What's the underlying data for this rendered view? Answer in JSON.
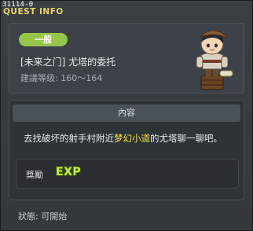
{
  "window": {
    "quest_id": "31114-0",
    "title": "QUEST INFO"
  },
  "quest": {
    "category_badge": "一般",
    "name": "[未来之门] 尤塔的委托",
    "level_range": "建議等级: 160～164",
    "npc_icon": "npc-adventurer-portrait"
  },
  "content": {
    "header": "內容",
    "description_before": "去找破坏的射手村附近",
    "description_highlight": "梦幻小道",
    "description_after": "的尤塔聊一聊吧。"
  },
  "reward": {
    "label": "獎勵",
    "exp_label": "EXP"
  },
  "status": {
    "text": "狀態:  可開始"
  },
  "colors": {
    "badge": "#96c54a",
    "title": "#e8d36a",
    "highlight": "#f4e14a"
  }
}
